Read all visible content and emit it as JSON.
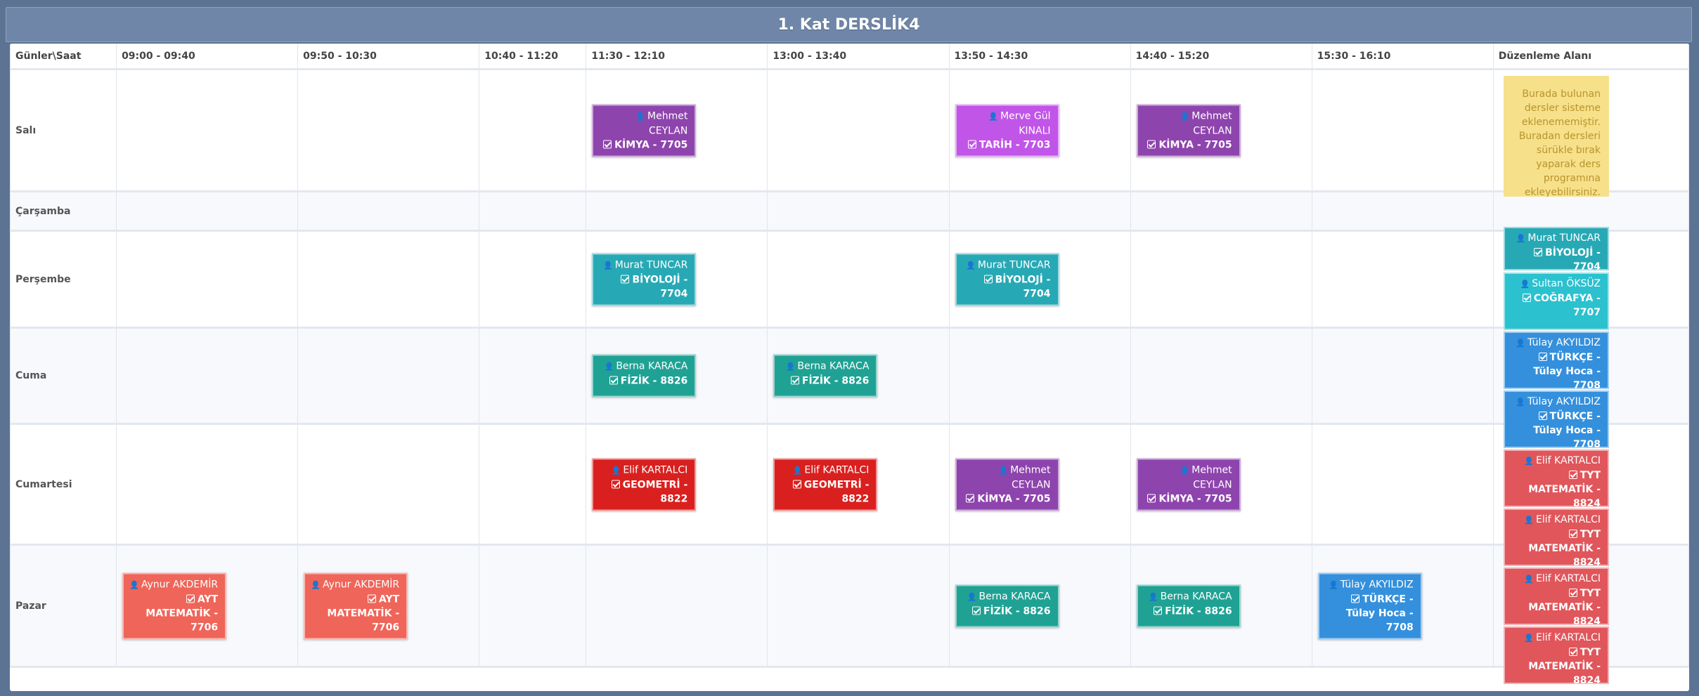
{
  "title": "1. Kat DERSLİK4",
  "header": {
    "corner": "Günler\\Saat",
    "slots": [
      "09:00 - 09:40",
      "09:50 - 10:30",
      "10:40 - 11:20",
      "11:30 - 12:10",
      "13:00 - 13:40",
      "13:50 - 14:30",
      "14:40 - 15:20",
      "15:30 - 16:10"
    ],
    "edit_area": "Düzenleme Alanı"
  },
  "colors": {
    "kimya": "#8e44ad",
    "tarih": "#c155e8",
    "biyoloji": "#27a9b5",
    "cografya": "#2bc1cf",
    "fizik": "#1fa294",
    "geometri": "#d9201e",
    "tyt_matematik": "#e0565b",
    "ayt_matematik": "#ef6559",
    "turkce": "#3490dc"
  },
  "days": [
    {
      "name": "Salı",
      "lessons": [
        {
          "slot": 3,
          "teacher": "Mehmet CEYLAN",
          "course": "KİMYA - 7705",
          "color": "kimya"
        },
        {
          "slot": 5,
          "teacher": "Merve Gül KINALI",
          "course": "TARİH - 7703",
          "color": "tarih"
        },
        {
          "slot": 6,
          "teacher": "Mehmet CEYLAN",
          "course": "KİMYA - 7705",
          "color": "kimya"
        }
      ]
    },
    {
      "name": "Çarşamba",
      "lessons": []
    },
    {
      "name": "Perşembe",
      "lessons": [
        {
          "slot": 3,
          "teacher": "Murat TUNCAR",
          "course": "BİYOLOJİ - 7704",
          "color": "biyoloji"
        },
        {
          "slot": 5,
          "teacher": "Murat TUNCAR",
          "course": "BİYOLOJİ - 7704",
          "color": "biyoloji"
        }
      ]
    },
    {
      "name": "Cuma",
      "lessons": [
        {
          "slot": 3,
          "teacher": "Berna KARACA",
          "course": "FİZİK - 8826",
          "color": "fizik"
        },
        {
          "slot": 4,
          "teacher": "Berna KARACA",
          "course": "FİZİK - 8826",
          "color": "fizik"
        }
      ]
    },
    {
      "name": "Cumartesi",
      "lessons": [
        {
          "slot": 3,
          "teacher": "Elif KARTALCI",
          "course": "GEOMETRİ - 8822",
          "color": "geometri"
        },
        {
          "slot": 4,
          "teacher": "Elif KARTALCI",
          "course": "GEOMETRİ - 8822",
          "color": "geometri"
        },
        {
          "slot": 5,
          "teacher": "Mehmet CEYLAN",
          "course": "KİMYA - 7705",
          "color": "kimya"
        },
        {
          "slot": 6,
          "teacher": "Mehmet CEYLAN",
          "course": "KİMYA - 7705",
          "color": "kimya"
        }
      ]
    },
    {
      "name": "Pazar",
      "lessons": [
        {
          "slot": 0,
          "teacher": "Aynur AKDEMİR",
          "course": "AYT MATEMATİK - 7706",
          "color": "ayt_matematik"
        },
        {
          "slot": 1,
          "teacher": "Aynur AKDEMİR",
          "course": "AYT MATEMATİK - 7706",
          "color": "ayt_matematik"
        },
        {
          "slot": 5,
          "teacher": "Berna KARACA",
          "course": "FİZİK - 8826",
          "color": "fizik"
        },
        {
          "slot": 6,
          "teacher": "Berna KARACA",
          "course": "FİZİK - 8826",
          "color": "fizik"
        },
        {
          "slot": 7,
          "teacher": "Tülay AKYILDIZ",
          "course": "TÜRKÇE - Tülay Hoca - 7708",
          "color": "turkce"
        }
      ]
    }
  ],
  "note": "Burada bulunan dersler sisteme eklenememiştir. Buradan dersleri sürükle bırak yaparak ders programına ekleyebilirsiniz.",
  "pool": [
    {
      "teacher": "Murat TUNCAR",
      "course": "BİYOLOJİ - 7704",
      "color": "biyoloji"
    },
    {
      "teacher": "Sultan ÖKSÜZ",
      "course": "COĞRAFYA - 7707",
      "color": "cografya"
    },
    {
      "teacher": "Tülay AKYILDIZ",
      "course": "TÜRKÇE - Tülay Hoca - 7708",
      "color": "turkce"
    },
    {
      "teacher": "Tülay AKYILDIZ",
      "course": "TÜRKÇE - Tülay Hoca - 7708",
      "color": "turkce"
    },
    {
      "teacher": "Elif KARTALCI",
      "course": "TYT MATEMATİK - 8824",
      "color": "tyt_matematik"
    },
    {
      "teacher": "Elif KARTALCI",
      "course": "TYT MATEMATİK - 8824",
      "color": "tyt_matematik"
    },
    {
      "teacher": "Elif KARTALCI",
      "course": "TYT MATEMATİK - 8824",
      "color": "tyt_matematik"
    },
    {
      "teacher": "Elif KARTALCI",
      "course": "TYT MATEMATİK - 8824",
      "color": "tyt_matematik"
    }
  ]
}
